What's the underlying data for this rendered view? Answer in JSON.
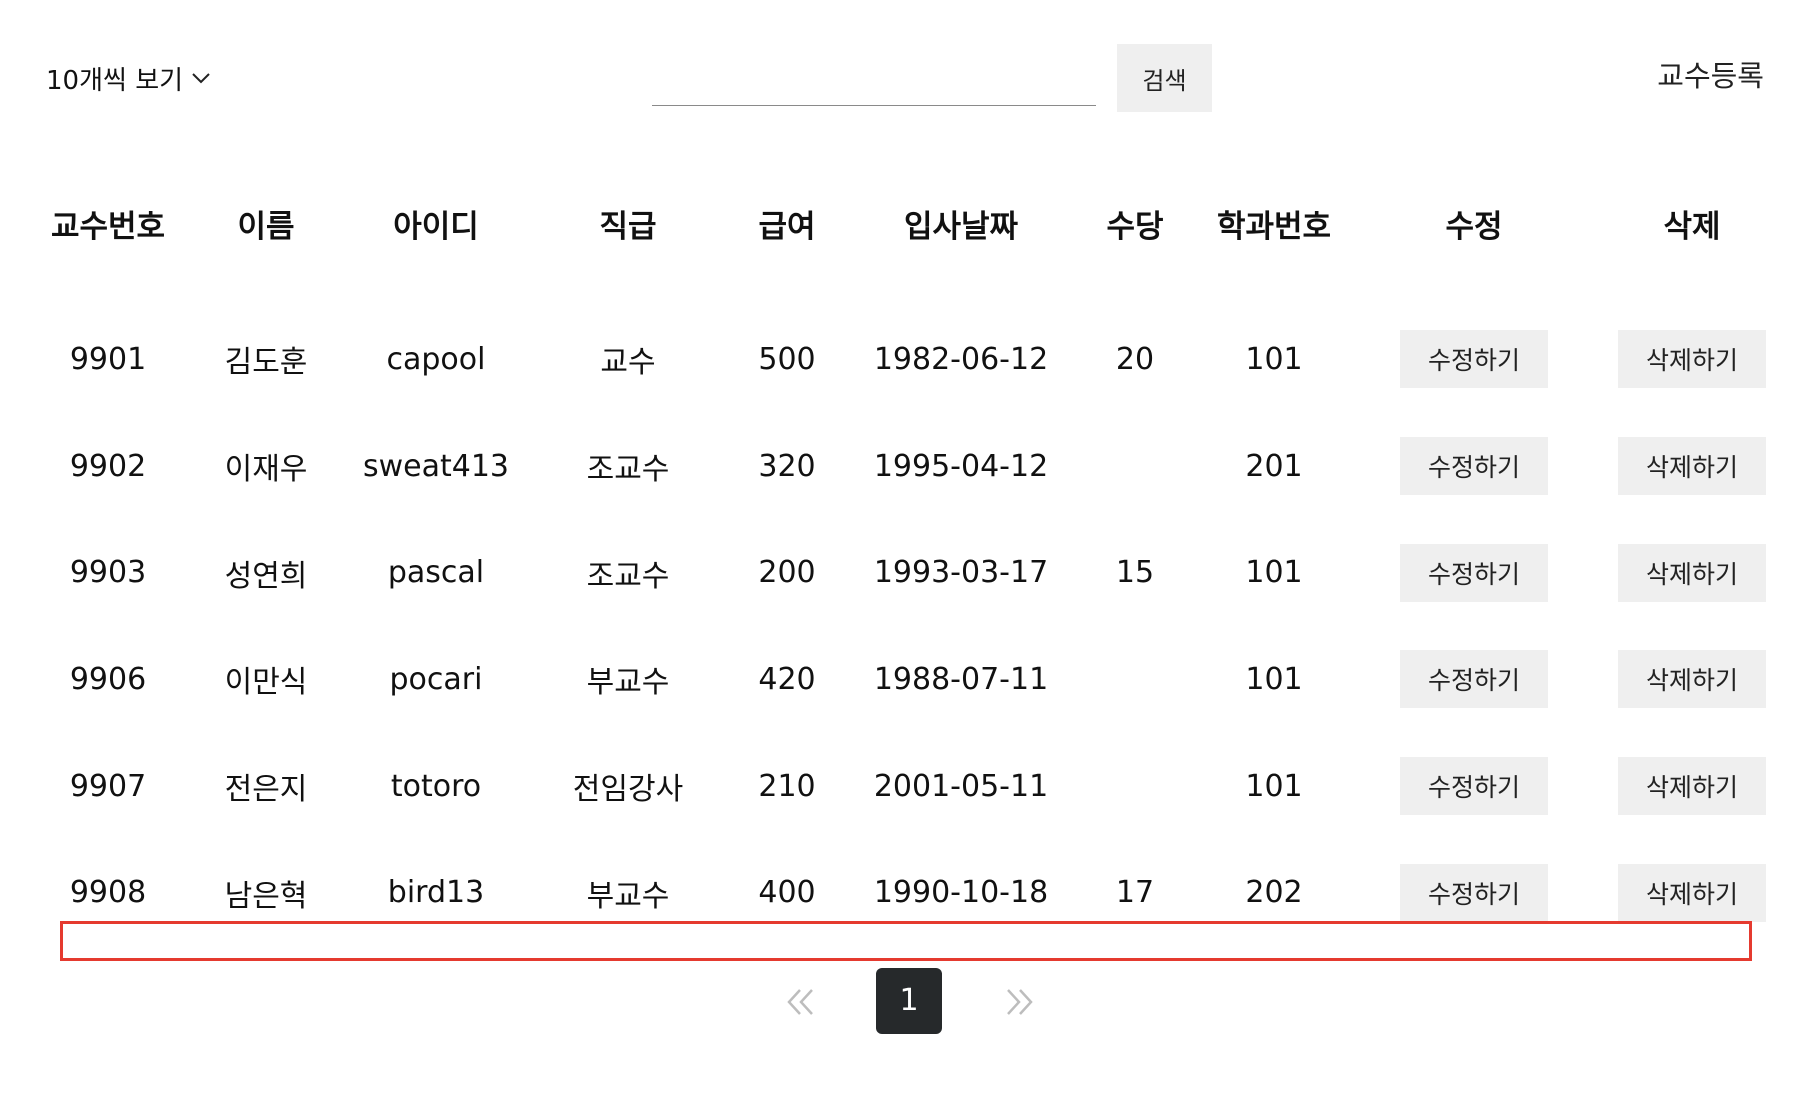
{
  "toolbar": {
    "page_size_label": "10개씩 보기",
    "search_value": "",
    "search_button": "검색",
    "register_label": "교수등록"
  },
  "table": {
    "headers": {
      "profno": "교수번호",
      "name": "이름",
      "userid": "아이디",
      "position": "직급",
      "pay": "급여",
      "hiredate": "입사날짜",
      "bonus": "수당",
      "deptno": "학과번호",
      "edit": "수정",
      "delete": "삭제"
    },
    "rows": [
      {
        "profno": "9901",
        "name": "김도훈",
        "userid": "capool",
        "position": "교수",
        "pay": "500",
        "hiredate": "1982-06-12",
        "bonus": "20",
        "deptno": "101",
        "edit": "수정하기",
        "delete": "삭제하기"
      },
      {
        "profno": "9902",
        "name": "이재우",
        "userid": "sweat413",
        "position": "조교수",
        "pay": "320",
        "hiredate": "1995-04-12",
        "bonus": "",
        "deptno": "201",
        "edit": "수정하기",
        "delete": "삭제하기"
      },
      {
        "profno": "9903",
        "name": "성연희",
        "userid": "pascal",
        "position": "조교수",
        "pay": "200",
        "hiredate": "1993-03-17",
        "bonus": "15",
        "deptno": "101",
        "edit": "수정하기",
        "delete": "삭제하기"
      },
      {
        "profno": "9906",
        "name": "이만식",
        "userid": "pocari",
        "position": "부교수",
        "pay": "420",
        "hiredate": "1988-07-11",
        "bonus": "",
        "deptno": "101",
        "edit": "수정하기",
        "delete": "삭제하기"
      },
      {
        "profno": "9907",
        "name": "전은지",
        "userid": "totoro",
        "position": "전임강사",
        "pay": "210",
        "hiredate": "2001-05-11",
        "bonus": "",
        "deptno": "101",
        "edit": "수정하기",
        "delete": "삭제하기"
      },
      {
        "profno": "9908",
        "name": "남은혁",
        "userid": "bird13",
        "position": "부교수",
        "pay": "400",
        "hiredate": "1990-10-18",
        "bonus": "17",
        "deptno": "202",
        "edit": "수정하기",
        "delete": "삭제하기"
      }
    ]
  },
  "pagination": {
    "current_page": "1",
    "prev_icon": "double-chevron-left-icon",
    "next_icon": "double-chevron-right-icon"
  },
  "colors": {
    "highlight": "#e53a2f",
    "button_bg": "#efefef",
    "current_page_bg": "#26292b"
  }
}
